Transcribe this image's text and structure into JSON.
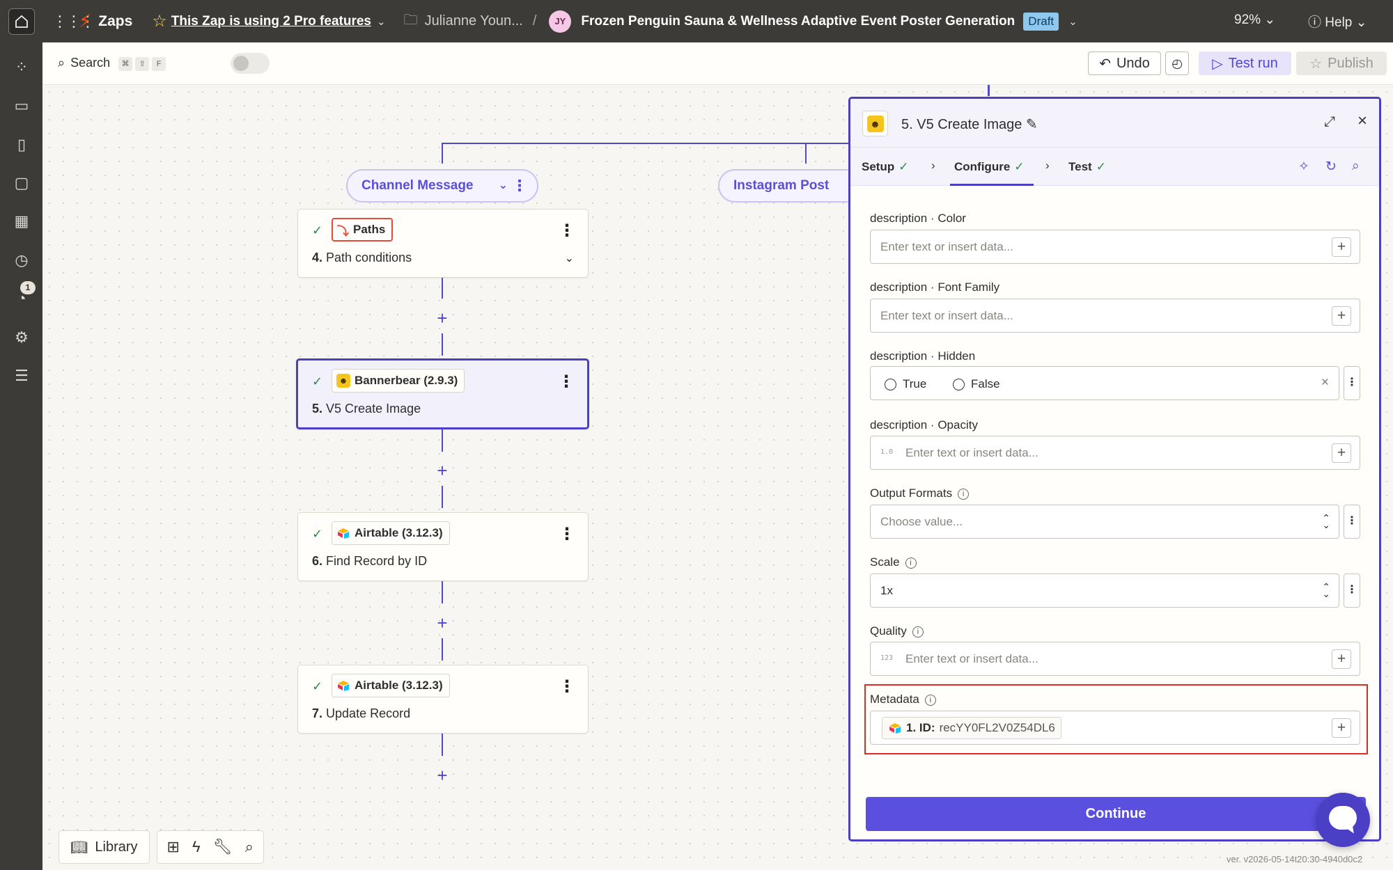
{
  "topbar": {
    "app_name": "Zaps",
    "pro_notice": "This Zap is using 2 Pro features",
    "folder_owner": "Julianne Youn...",
    "separator": "/",
    "avatar_initials": "JY",
    "zap_title": "Frozen Penguin Sauna & Wellness Adaptive Event Poster Generation",
    "status_badge": "Draft",
    "zoom": "92%",
    "help": "Help"
  },
  "rail": {
    "notification_count": "1"
  },
  "toolbar": {
    "search_label": "Search",
    "shortcut_keys": [
      "⌘",
      "⇧",
      "F"
    ],
    "undo_label": "Undo",
    "test_run_label": "Test run",
    "publish_label": "Publish"
  },
  "canvas": {
    "paths": [
      {
        "label": "Channel Message"
      },
      {
        "label": "Instagram Post"
      }
    ],
    "steps": [
      {
        "app": "Paths",
        "number": "4.",
        "title": "Path conditions"
      },
      {
        "app": "Bannerbear (2.9.3)",
        "number": "5.",
        "title": "V5 Create Image"
      },
      {
        "app": "Airtable (3.12.3)",
        "number": "6.",
        "title": "Find Record by ID"
      },
      {
        "app": "Airtable (3.12.3)",
        "number": "7.",
        "title": "Update Record"
      }
    ]
  },
  "panel": {
    "title": "5. V5 Create Image",
    "tabs": [
      {
        "label": "Setup"
      },
      {
        "label": "Configure"
      },
      {
        "label": "Test"
      }
    ],
    "fields": {
      "color": {
        "label": "description · Color",
        "placeholder": "Enter text or insert data..."
      },
      "font_family": {
        "label": "description · Font Family",
        "placeholder": "Enter text or insert data..."
      },
      "hidden": {
        "label": "description · Hidden",
        "options": [
          "True",
          "False"
        ]
      },
      "opacity": {
        "label": "description · Opacity",
        "type_tag": "1.0",
        "placeholder": "Enter text or insert data..."
      },
      "output_formats": {
        "label": "Output Formats",
        "placeholder": "Choose value..."
      },
      "scale": {
        "label": "Scale",
        "value": "1x"
      },
      "quality": {
        "label": "Quality",
        "type_tag": "123",
        "placeholder": "Enter text or insert data..."
      },
      "metadata": {
        "label": "Metadata",
        "chip_key": "1. ID:",
        "chip_value": "recYY0FL2V0Z54DL6"
      }
    },
    "continue_label": "Continue"
  },
  "bottom": {
    "library_label": "Library",
    "version": "ver. v2026-05-14t20:30-4940d0c2"
  },
  "colors": {
    "accent": "#4b3fc5",
    "zapier_orange": "#ff4f00",
    "success": "#2c8a4a",
    "highlight": "#e02b20"
  }
}
